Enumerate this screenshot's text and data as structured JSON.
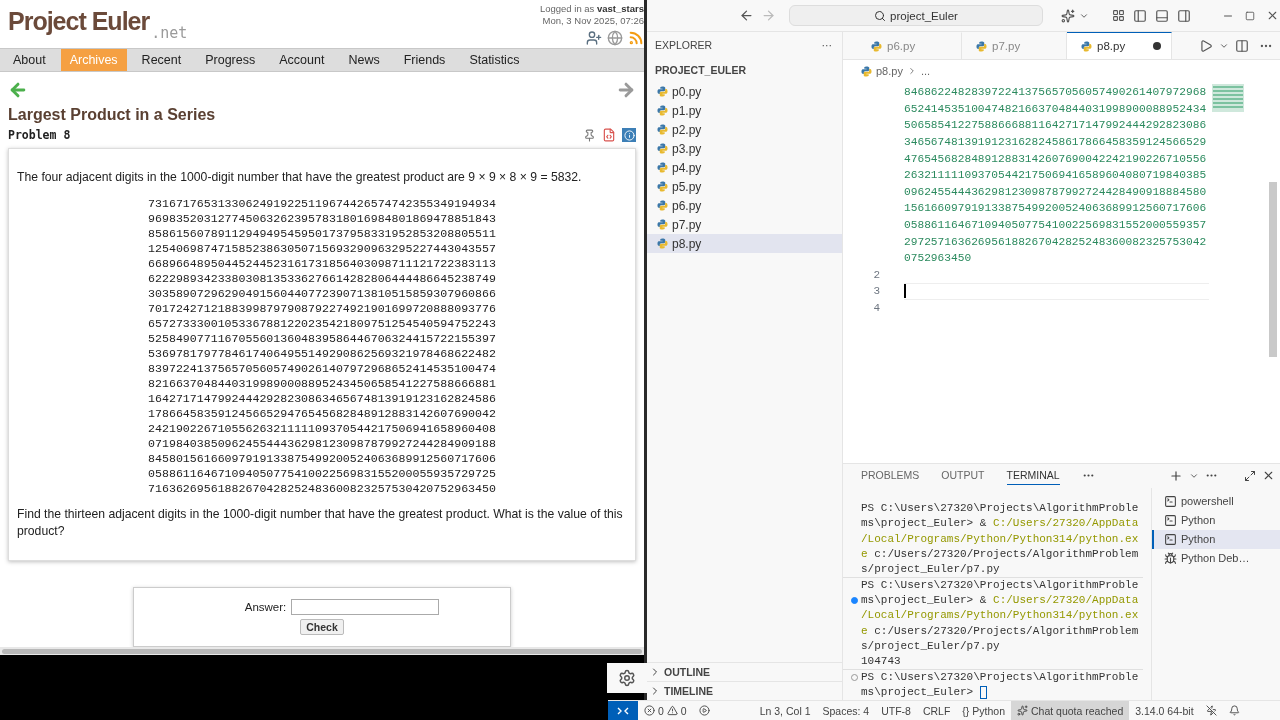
{
  "browser": {
    "logo": {
      "name": "Project Euler",
      "suffix": ".net"
    },
    "login": {
      "prefix": "Logged in as ",
      "user": "vast_stars"
    },
    "date": "Mon, 3 Nov 2025, 07:26",
    "nav": [
      {
        "label": "About",
        "selected": false
      },
      {
        "label": "Archives",
        "selected": true
      },
      {
        "label": "Recent",
        "selected": false
      },
      {
        "label": "Progress",
        "selected": false
      },
      {
        "label": "Account",
        "selected": false
      },
      {
        "label": "News",
        "selected": false
      },
      {
        "label": "Friends",
        "selected": false
      },
      {
        "label": "Statistics",
        "selected": false
      }
    ],
    "problem": {
      "title": "Largest Product in a Series",
      "number": "Problem 8",
      "intro": "The four adjacent digits in the 1000-digit number that have the greatest product are 9 × 9 × 8 × 9 = 5832.",
      "digits": [
        "73167176531330624919225119674426574742355349194934",
        "96983520312774506326239578318016984801869478851843",
        "85861560789112949495459501737958331952853208805511",
        "12540698747158523863050715693290963295227443043557",
        "66896648950445244523161731856403098711121722383113",
        "62229893423380308135336276614282806444486645238749",
        "30358907296290491560440772390713810515859307960866",
        "70172427121883998797908792274921901699720888093776",
        "65727333001053367881220235421809751254540594752243",
        "52584907711670556013604839586446706324415722155397",
        "53697817977846174064955149290862569321978468622482",
        "83972241375657056057490261407972968652414535100474",
        "82166370484403199890008895243450658541227588666881",
        "16427171479924442928230863465674813919123162824586",
        "17866458359124566529476545682848912883142607690042",
        "24219022671055626321111109370544217506941658960408",
        "07198403850962455444362981230987879927244284909188",
        "84580156166097919133875499200524063689912560717606",
        "05886116467109405077541002256983155200055935729725",
        "71636269561882670428252483600823257530420752963450"
      ],
      "question": "Find the thirteen adjacent digits in the 1000-digit number that have the greatest product. What is the value of this product?"
    },
    "answer": {
      "label": "Answer:",
      "button": "Check"
    }
  },
  "vscode": {
    "search": "project_Euler",
    "explorer": {
      "title": "EXPLORER",
      "more": "···",
      "project": "PROJECT_EULER",
      "files": [
        {
          "name": "p0.py",
          "selected": false
        },
        {
          "name": "p1.py",
          "selected": false
        },
        {
          "name": "p2.py",
          "selected": false
        },
        {
          "name": "p3.py",
          "selected": false
        },
        {
          "name": "p4.py",
          "selected": false
        },
        {
          "name": "p5.py",
          "selected": false
        },
        {
          "name": "p6.py",
          "selected": false
        },
        {
          "name": "p7.py",
          "selected": false
        },
        {
          "name": "p8.py",
          "selected": true
        }
      ],
      "sections": [
        {
          "label": "OUTLINE",
          "expanded": false
        },
        {
          "label": "TIMELINE",
          "expanded": false
        }
      ]
    },
    "tabs": [
      {
        "label": "p6.py",
        "selected": false,
        "modified": false
      },
      {
        "label": "p7.py",
        "selected": false,
        "modified": false
      },
      {
        "label": "p8.py",
        "selected": true,
        "modified": true
      }
    ],
    "breadcrumb": {
      "file": "p8.py",
      "rest": "..."
    },
    "wrapped": [
      "846862248283972241375657056057490261407972968",
      "652414535100474821663704844031998900088952434",
      "506585412275886668811642717147992444292823086",
      "346567481391912316282458617866458359124566529",
      "476545682848912883142607690042242190226710556",
      "263211111093705442175069416589604080719840385",
      "096245544436298123098787992724428490918884580",
      "156166097919133875499200524063689912560717606",
      "058861164671094050775410022569831552000559357",
      "297257163626956188267042825248360082325753042",
      "0752963450"
    ],
    "lines": [
      {
        "number": "2",
        "current": false
      },
      {
        "number": "3",
        "current": true
      },
      {
        "number": "4",
        "current": false
      }
    ],
    "panel_tabs": [
      {
        "label": "PROBLEMS",
        "selected": false
      },
      {
        "label": "OUTPUT",
        "selected": false
      },
      {
        "label": "TERMINAL",
        "selected": true
      }
    ],
    "terminal": [
      {
        "rows": [
          {
            "segments": [
              {
                "text": "PS C:\\Users\\27320\\Projects\\AlgorithmProble",
                "kind": "plain"
              }
            ]
          },
          {
            "segments": [
              {
                "text": "ms\\project_Euler> & ",
                "kind": "plain"
              },
              {
                "text": "C:/Users/27320/AppData",
                "kind": "path"
              }
            ]
          },
          {
            "segments": [
              {
                "text": "/Local/Programs/Python/Python314/python.ex",
                "kind": "path"
              }
            ]
          },
          {
            "segments": [
              {
                "text": "e",
                "kind": "path"
              },
              {
                "text": " c:/Users/27320/Projects/AlgorithmProblem",
                "kind": "plain"
              }
            ]
          },
          {
            "segments": [
              {
                "text": "s/project_Euler/p7.py",
                "kind": "plain"
              }
            ]
          }
        ]
      },
      {
        "rows": [
          {
            "segments": [
              {
                "text": "PS C:\\Users\\27320\\Projects\\AlgorithmProble",
                "kind": "plain"
              }
            ]
          },
          {
            "status_dot": true,
            "succeeded": true,
            "segments": [
              {
                "text": "ms\\project_Euler> & ",
                "kind": "plain"
              },
              {
                "text": "C:/Users/27320/AppData",
                "kind": "path"
              }
            ]
          },
          {
            "segments": [
              {
                "text": "/Local/Programs/Python/Python314/python.ex",
                "kind": "path"
              }
            ]
          },
          {
            "segments": [
              {
                "text": "e",
                "kind": "path"
              },
              {
                "text": " c:/Users/27320/Projects/AlgorithmProblem",
                "kind": "plain"
              }
            ]
          },
          {
            "segments": [
              {
                "text": "s/project_Euler/p7.py",
                "kind": "plain"
              }
            ]
          },
          {
            "segments": [
              {
                "text": "104743",
                "kind": "plain"
              }
            ]
          }
        ]
      },
      {
        "rows": [
          {
            "status_dot": true,
            "succeeded": false,
            "segments": [
              {
                "text": "PS C:\\Users\\27320\\Projects\\AlgorithmProble",
                "kind": "plain"
              }
            ]
          },
          {
            "cursor": true,
            "segments": [
              {
                "text": "ms\\project_Euler> ",
                "kind": "plain"
              }
            ]
          }
        ]
      }
    ],
    "terminals": [
      {
        "label": "powershell",
        "kind": "shell",
        "selected": false
      },
      {
        "label": "Python",
        "kind": "shell",
        "selected": false
      },
      {
        "label": "Python",
        "kind": "shell",
        "selected": true
      },
      {
        "label": "Python Deb…",
        "kind": "debug",
        "selected": false
      }
    ],
    "status_bar": {
      "errors": "0",
      "warnings": "0",
      "position": "Ln 3, Col 1",
      "indent": "Spaces: 4",
      "encoding": "UTF-8",
      "eol": "CRLF",
      "braces": "{}",
      "language": "Python",
      "chat": {
        "text": "Chat quota reached",
        "highlighted": true
      },
      "version": "3.14.0 64-bit"
    }
  }
}
